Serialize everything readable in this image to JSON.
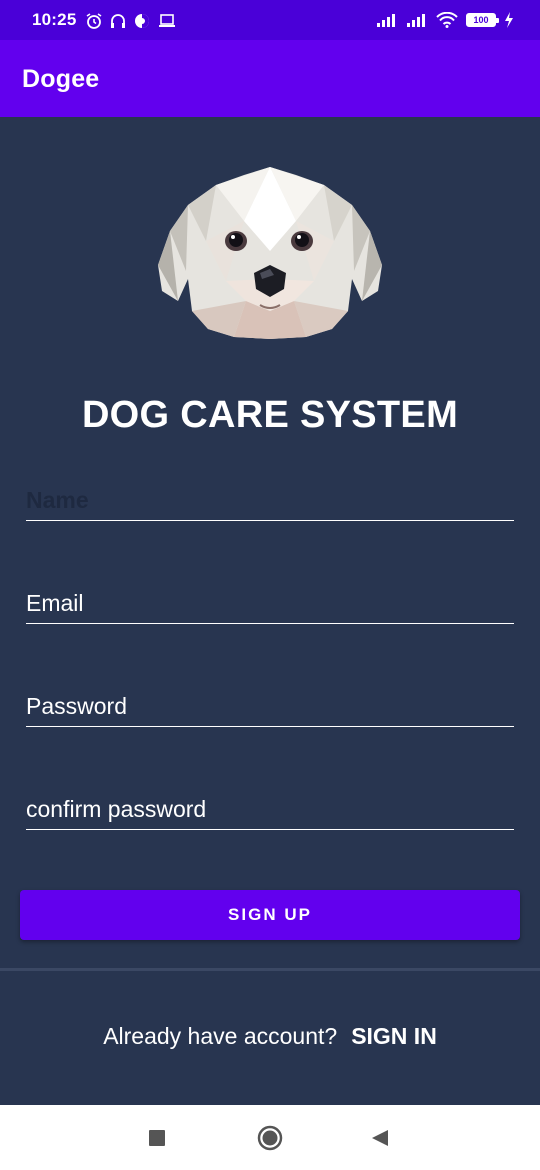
{
  "status_bar": {
    "time": "10:25",
    "battery_level": "100",
    "icons": [
      "alarm-icon",
      "headset-icon",
      "vpn-icon",
      "laptop-icon",
      "signal-icon",
      "signal-icon",
      "wifi-icon",
      "battery-icon",
      "charging-icon"
    ]
  },
  "app_bar": {
    "title": "Dogee"
  },
  "main": {
    "logo_icon": "dog-face-icon",
    "headline": "DOG CARE SYSTEM",
    "fields": {
      "name": {
        "placeholder": "Name",
        "value": ""
      },
      "email": {
        "placeholder": "Email",
        "value": ""
      },
      "password": {
        "placeholder": "Password",
        "value": ""
      },
      "confirm_password": {
        "placeholder": "confirm password",
        "value": ""
      }
    },
    "signup_label": "SIGN UP",
    "signin_prompt": "Already have account?",
    "signin_label": "SIGN IN"
  },
  "nav_bar": {
    "icons": [
      "recents-icon",
      "home-icon",
      "back-icon"
    ]
  },
  "colors": {
    "status_bar": "#4a00d8",
    "app_bar": "#6200ee",
    "background": "#283550",
    "button": "#6200ee",
    "text": "#ffffff"
  }
}
